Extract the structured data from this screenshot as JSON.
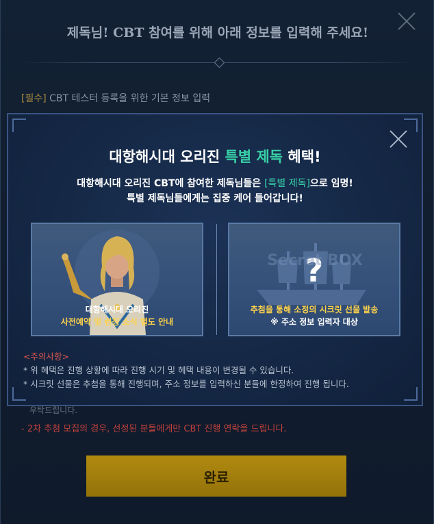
{
  "back": {
    "title": "제독님! CBT 참여를 위해 아래 정보를 입력해 주세요!",
    "section_required": "[필수]",
    "section_label": " CBT 테스터 등록을 위한 기본 정보 입력",
    "note_partial": "우탁드립니다.",
    "note_second": "- 2차 추첨 모집의 경우, 선정된 분들에게만 CBT 진행 연락을 드립니다.",
    "complete_button": "완료"
  },
  "modal": {
    "title_prefix": "대항해시대 오리진 ",
    "title_highlight": "특별 제독",
    "title_suffix": " 혜택!",
    "desc_line1_prefix": "대항해시대 오리진 CBT에 참여한 제독님들은 ",
    "desc_line1_highlight": "[특별 제독]",
    "desc_line1_suffix": "으로 임명!",
    "desc_line2": "특별 제독님들에게는 집중 케어 들어갑니다!",
    "cards": [
      {
        "caption_line1": "대항해시대 오리진",
        "caption_line2": "사전예약 및 런칭 소식 별도 안내",
        "icon": "admiral-portrait"
      },
      {
        "watermark": "Secret BOX",
        "caption_line1": "추첨을 통해 소정의 시크릿 선물 발송",
        "caption_line2": "※ 주소 정보 입력자 대상",
        "icon": "secret-box-ship"
      }
    ],
    "notice_title": "<주의사항>",
    "notice_lines": [
      "* 위 혜택은 진행 상황에 따라 진행 시기 및 혜택 내용이 변경될 수 있습니다.",
      "* 시크릿 선물은 추첨을 통해 진행되며, 주소 정보를 입력하신 분들에 한정하여 진행 됩니다."
    ]
  },
  "colors": {
    "accent_teal": "#38d1a8",
    "button_gold": "#b08a10",
    "warning_red": "#e0564d",
    "caption_yellow": "#ffd34a"
  }
}
